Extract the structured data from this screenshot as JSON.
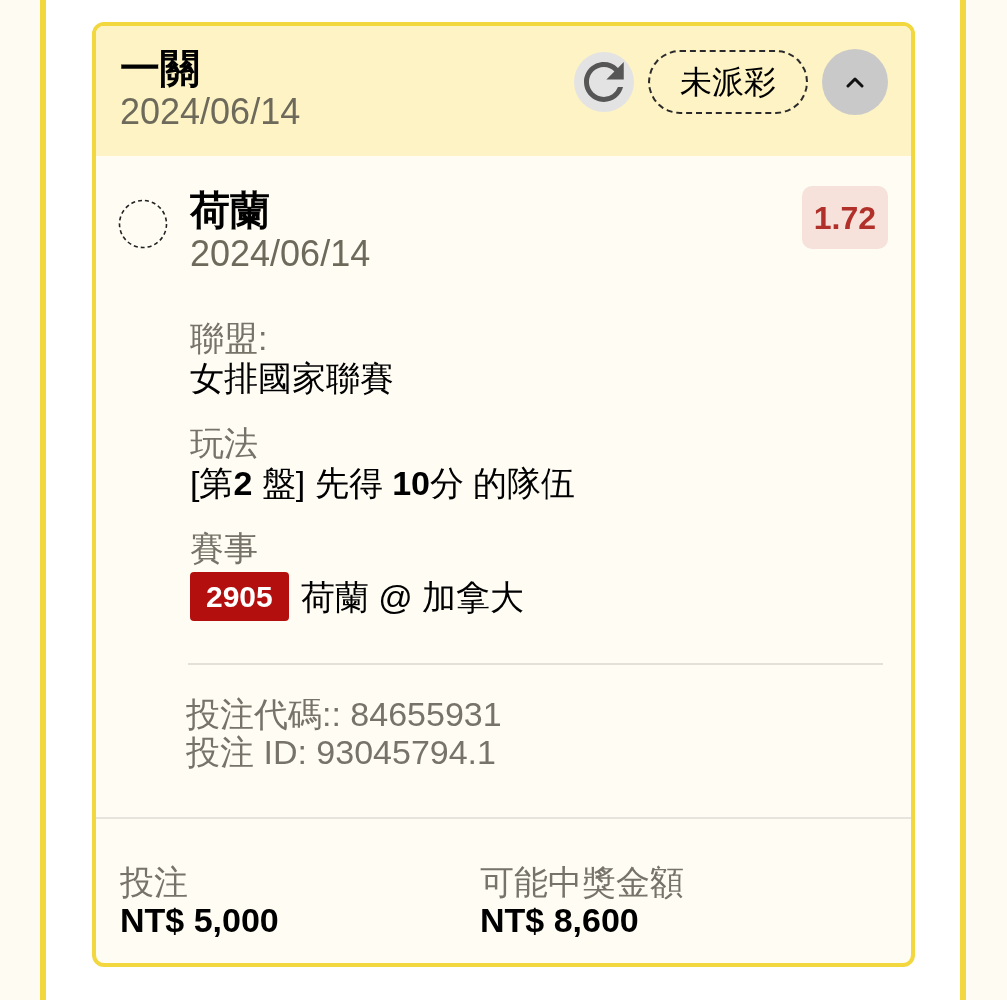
{
  "bet_card": {
    "header": {
      "title": "一關",
      "date": "2024/06/14",
      "status": "未派彩",
      "expanded": true
    },
    "selection": {
      "team": "荷蘭",
      "date": "2024/06/14",
      "odds": "1.72"
    },
    "details": [
      {
        "kind": "text",
        "label": "聯盟:",
        "value": "女排國家聯賽"
      },
      {
        "kind": "text",
        "label": "玩法",
        "value": "[第**2** 盤] 先得 **10**分 的隊伍"
      },
      {
        "kind": "event",
        "label": "賽事",
        "event_code": "2905",
        "value": "荷蘭 @ 加拿大"
      }
    ],
    "bet_code": "投注代碼:: 84655931",
    "bet_id": "投注 ID: 93045794.1",
    "footer": [
      {
        "label": "投注",
        "value": "NT$ 5,000"
      },
      {
        "label": "可能中獎金額",
        "value": "NT$ 8,600"
      }
    ]
  }
}
